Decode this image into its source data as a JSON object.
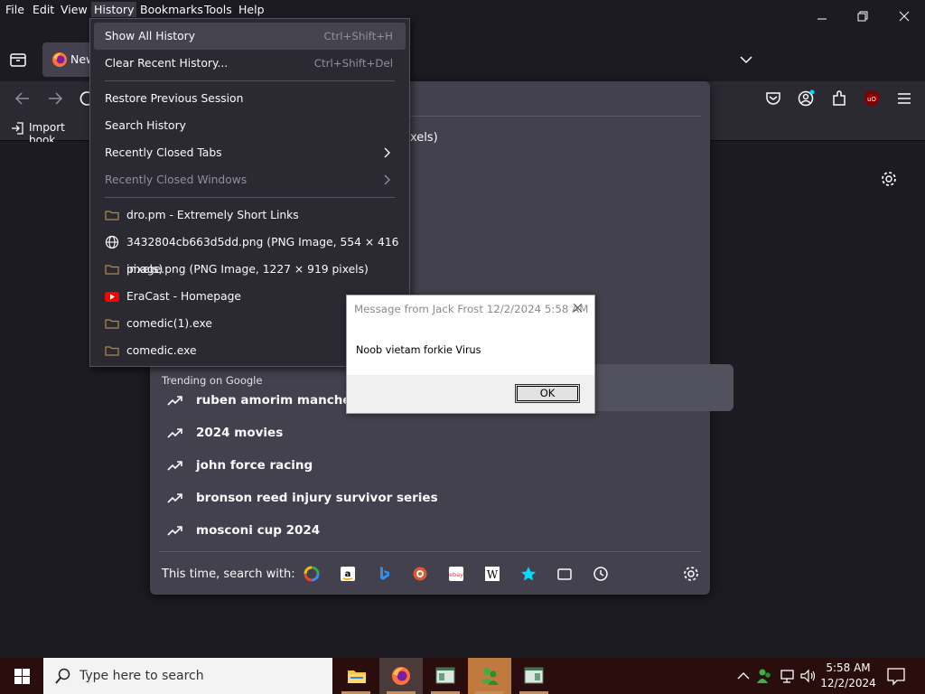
{
  "menubar": {
    "items": [
      "File",
      "Edit",
      "View",
      "History",
      "Bookmarks",
      "Tools",
      "Help"
    ]
  },
  "tabs": {
    "active_title": "New"
  },
  "bookmarks_bar": {
    "import_label": "Import book"
  },
  "urlbar_panel": {
    "partial_result_text": "xels)",
    "trending_heading": "Trending on Google",
    "trending": [
      "ruben amorim mancheste",
      "2024 movies",
      "john force racing",
      "bronson reed injury survivor series",
      "mosconi cup 2024"
    ],
    "search_with_label": "This time, search with:",
    "engines": [
      "google-icon",
      "amazon-icon",
      "bing-icon",
      "duckduckgo-icon",
      "ebay-icon",
      "wikipedia-icon",
      "bookmarks-star-icon",
      "tabs-icon",
      "history-clock-icon"
    ]
  },
  "history_menu": {
    "show_all": "Show All History",
    "show_all_shortcut": "Ctrl+Shift+H",
    "clear_recent": "Clear Recent History...",
    "clear_recent_shortcut": "Ctrl+Shift+Del",
    "restore": "Restore Previous Session",
    "search": "Search History",
    "recent_tabs": "Recently Closed Tabs",
    "recent_windows": "Recently Closed Windows",
    "entries": [
      "dro.pm - Extremely Short Links",
      "3432804cb663d5dd.png (PNG Image, 554 × 416 pixels)",
      "image.png (PNG Image, 1227 × 919 pixels)",
      "EraCast - Homepage",
      "comedic(1).exe",
      "comedic.exe"
    ]
  },
  "dialog": {
    "title": "Message from Jack Frost 12/2/2024 5:58 AM",
    "message": "Noob vietam forkie Virus",
    "ok_label": "OK"
  },
  "taskbar": {
    "search_placeholder": "Type here to search",
    "time": "5:58 AM",
    "date": "12/2/2024"
  },
  "colors": {
    "accent_taskbar": "#2a0d0d",
    "menu_bg": "#2b2a33",
    "panel_bg": "#42414d"
  }
}
